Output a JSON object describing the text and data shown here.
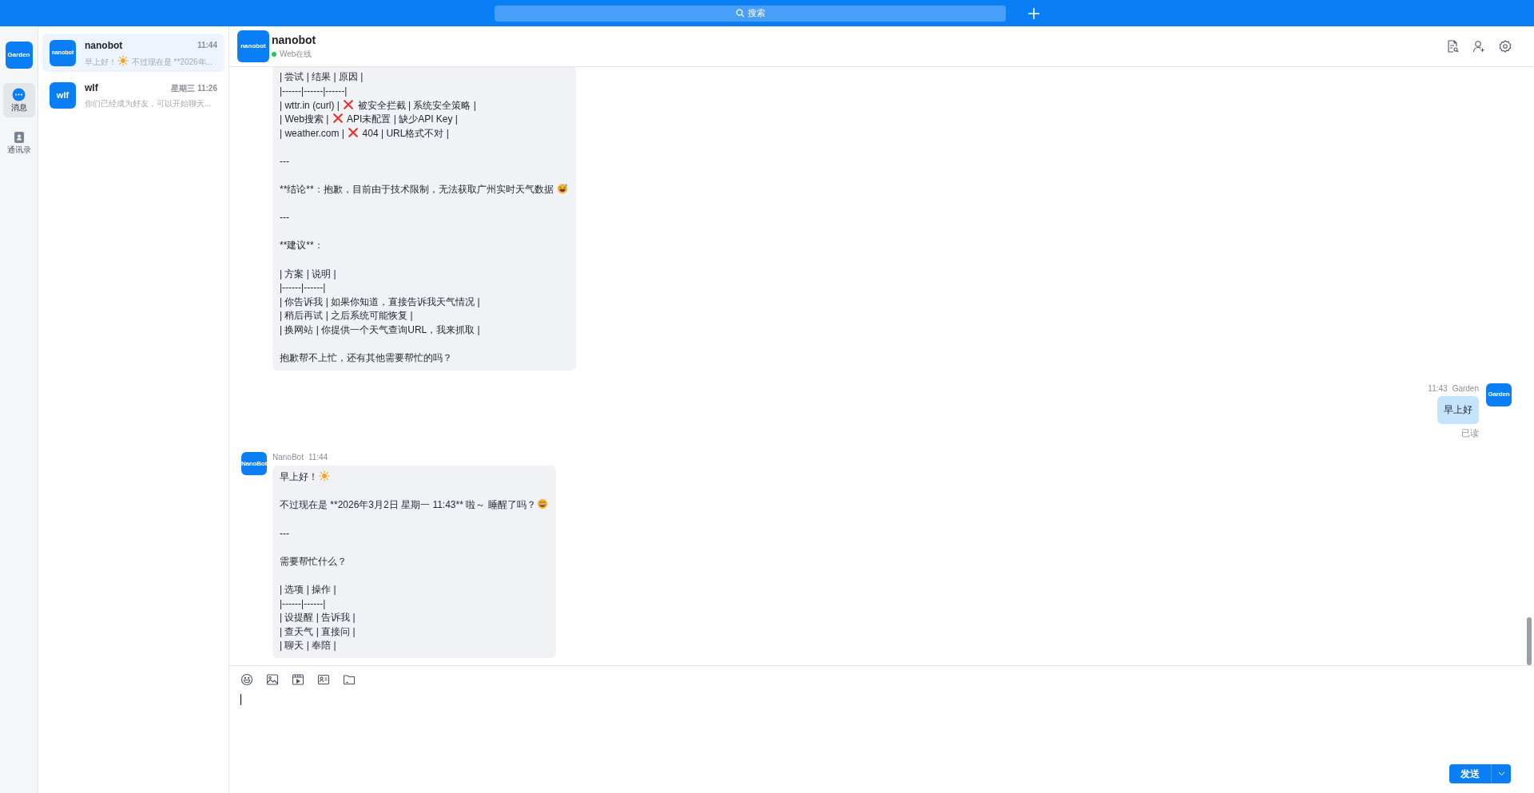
{
  "topbar": {
    "search": {
      "placeholder": "搜索"
    }
  },
  "nav": {
    "user_avatar": "Garden",
    "items": [
      {
        "kind": "messages",
        "label": "消息",
        "selected": true
      },
      {
        "kind": "contacts",
        "label": "通讯录",
        "selected": false
      }
    ]
  },
  "conversations": [
    {
      "avatar": "nanobot",
      "name": "nanobot",
      "time": "11:44",
      "selected": true,
      "preview": [
        {
          "kind": "text",
          "text": "早上好！"
        },
        {
          "kind": "sun"
        },
        {
          "kind": "text",
          "text": " 不过现在是 **2026年..."
        }
      ]
    },
    {
      "avatar": "wlf",
      "name": "wlf",
      "time": "星期三 11:26",
      "selected": false,
      "preview": [
        {
          "kind": "text",
          "text": "你们已经成为好友，可以开始聊天..."
        }
      ]
    }
  ],
  "chat": {
    "avatar": "nanobot",
    "title": "nanobot",
    "online": true,
    "status": "Web在线",
    "messages": [
      {
        "kind": "incoming",
        "blocks": [
          [
            [
              {
                "kind": "text",
                "text": "| 尝试 | 结果 | 原因 |"
              }
            ],
            [
              {
                "kind": "text",
                "text": "|------|------|------|"
              }
            ],
            [
              {
                "kind": "text",
                "text": "| wttr.in (curl) | "
              },
              {
                "kind": "cross"
              },
              {
                "kind": "text",
                "text": " 被安全拦截 | 系统安全策略 |"
              }
            ],
            [
              {
                "kind": "text",
                "text": "| Web搜索 | "
              },
              {
                "kind": "cross"
              },
              {
                "kind": "text",
                "text": " API未配置 | 缺少API Key |"
              }
            ],
            [
              {
                "kind": "text",
                "text": "| weather.com | "
              },
              {
                "kind": "cross"
              },
              {
                "kind": "text",
                "text": " 404 | URL格式不对 |"
              }
            ]
          ],
          [
            [
              {
                "kind": "text",
                "text": "---"
              }
            ]
          ],
          [
            [
              {
                "kind": "text",
                "text": "**结论**：抱歉，目前由于技术限制，无法获取广州实时天气数据 "
              },
              {
                "kind": "sweat-smile"
              }
            ]
          ],
          [
            [
              {
                "kind": "text",
                "text": "---"
              }
            ]
          ],
          [
            [
              {
                "kind": "text",
                "text": "**建议**："
              }
            ]
          ],
          [
            [
              {
                "kind": "text",
                "text": "| 方案 | 说明 |"
              }
            ],
            [
              {
                "kind": "text",
                "text": "|------|------|"
              }
            ],
            [
              {
                "kind": "text",
                "text": "| 你告诉我 | 如果你知道，直接告诉我天气情况 |"
              }
            ],
            [
              {
                "kind": "text",
                "text": "| 稍后再试 | 之后系统可能恢复 |"
              }
            ],
            [
              {
                "kind": "text",
                "text": "| 换网站 | 你提供一个天气查询URL，我来抓取 |"
              }
            ]
          ],
          [
            [
              {
                "kind": "text",
                "text": "抱歉帮不上忙，还有其他需要帮忙的吗？"
              }
            ]
          ]
        ]
      },
      {
        "kind": "outgoing",
        "time": "11:43",
        "sender": "Garden",
        "avatar": "Garden",
        "receipt": "已读",
        "blocks": [
          [
            [
              {
                "kind": "text",
                "text": "早上好"
              }
            ]
          ]
        ]
      },
      {
        "kind": "incoming",
        "sender": "NanoBot",
        "time": "11:44",
        "avatar": "NanoBot",
        "blocks": [
          [
            [
              {
                "kind": "text",
                "text": "早上好！"
              },
              {
                "kind": "sun"
              }
            ]
          ],
          [
            [
              {
                "kind": "text",
                "text": "不过现在是 **2026年3月2日 星期一 11:43** 啦～ 睡醒了吗？"
              },
              {
                "kind": "grin"
              }
            ]
          ],
          [
            [
              {
                "kind": "text",
                "text": "---"
              }
            ]
          ],
          [
            [
              {
                "kind": "text",
                "text": "需要帮忙什么？"
              }
            ]
          ],
          [
            [
              {
                "kind": "text",
                "text": "| 选项 | 操作 |"
              }
            ],
            [
              {
                "kind": "text",
                "text": "|------|------|"
              }
            ],
            [
              {
                "kind": "text",
                "text": "| 设提醒 | 告诉我 |"
              }
            ],
            [
              {
                "kind": "text",
                "text": "| 查天气 | 直接问 |"
              }
            ],
            [
              {
                "kind": "text",
                "text": "| 聊天 | 奉陪 |"
              }
            ]
          ]
        ]
      }
    ]
  },
  "composer": {
    "send": {
      "label": "发送"
    }
  }
}
